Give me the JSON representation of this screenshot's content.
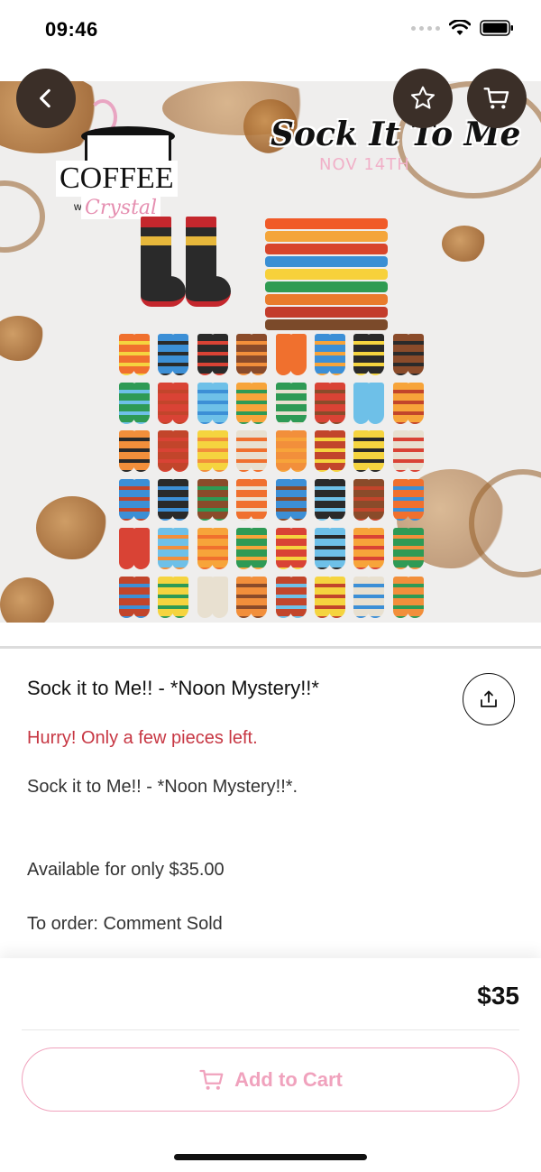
{
  "status_bar": {
    "time": "09:46",
    "icons": [
      "signal-dots-icon",
      "wifi-icon",
      "battery-icon"
    ]
  },
  "header": {
    "back_icon": "chevron-left-icon",
    "favorite_icon": "star-icon",
    "cart_icon": "cart-icon"
  },
  "hero_image": {
    "brand_logo": "Coffee with Crystal",
    "brand_logo_top": "COFFEE",
    "brand_logo_with": "with",
    "brand_logo_script": "Crystal",
    "event_title": "Sock It To Me",
    "event_date": "NOV 14TH",
    "carousel": {
      "current_page": 1,
      "total_pages": 1
    }
  },
  "product": {
    "title": "Sock it to Me!! - *Noon Mystery!!*",
    "stock_note": "Hurry! Only a few pieces left.",
    "description": "Sock it to Me!! - *Noon Mystery!!*.",
    "availability": "Available for only $35.00",
    "order_info": "To order: Comment Sold",
    "share_icon": "share-icon"
  },
  "footer": {
    "price": "$35",
    "add_to_cart_label": "Add to Cart",
    "add_to_cart_icon": "cart-icon"
  },
  "colors": {
    "accent_pink": "#f0a2bd",
    "warning_red": "#c73743",
    "button_dark": "#3b2f28"
  }
}
